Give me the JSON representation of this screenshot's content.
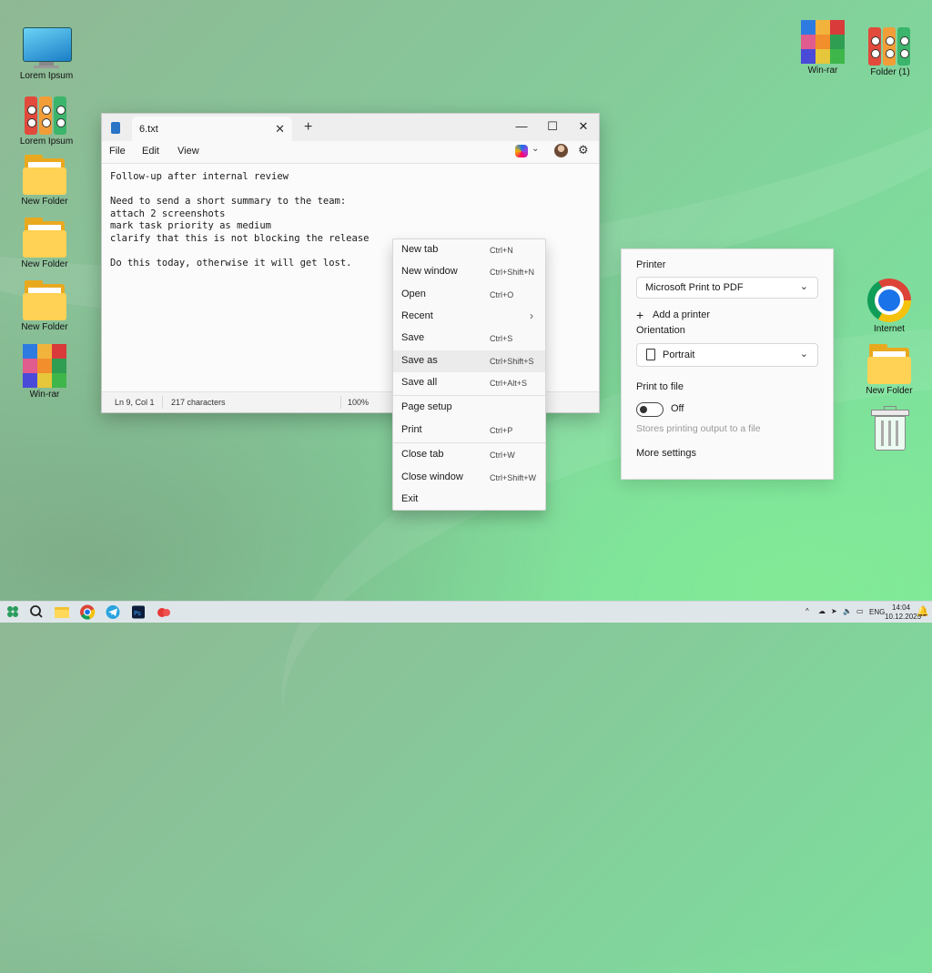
{
  "desktop": {
    "left_icons": [
      {
        "label": "Lorem Ipsum",
        "icon": "monitor-icon"
      },
      {
        "label": "Lorem Ipsum",
        "icon": "binders-icon"
      },
      {
        "label": "New Folder",
        "icon": "folder-icon"
      },
      {
        "label": "New Folder",
        "icon": "folder-icon"
      },
      {
        "label": "New Folder",
        "icon": "folder-icon"
      },
      {
        "label": "Win-rar",
        "icon": "winrar-icon"
      }
    ],
    "right_icons": [
      {
        "label": "Win-rar",
        "icon": "winrar-icon"
      },
      {
        "label": "Folder (1)",
        "icon": "binders-icon"
      },
      {
        "label": "Internet",
        "icon": "chrome-icon"
      },
      {
        "label": "New Folder",
        "icon": "folder-icon"
      },
      {
        "label": "",
        "icon": "recycle-bin-icon"
      }
    ]
  },
  "notepad": {
    "tab_title": "6.txt",
    "menu": [
      "File",
      "Edit",
      "View"
    ],
    "content": "Follow-up after internal review\n\nNeed to send a short summary to the team:\nattach 2 screenshots\nmark task priority as medium\nclarify that this is not blocking the release\n\nDo this today, otherwise it will get lost.",
    "status": {
      "position": "Ln 9, Col 1",
      "chars": "217 characters",
      "zoom": "100%"
    }
  },
  "file_menu": {
    "items": [
      {
        "label": "New tab",
        "shortcut": "Ctrl+N"
      },
      {
        "label": "New window",
        "shortcut": "Ctrl+Shift+N"
      },
      {
        "label": "Open",
        "shortcut": "Ctrl+O"
      },
      {
        "label": "Recent",
        "shortcut": ""
      },
      {
        "label": "Save",
        "shortcut": "Ctrl+S"
      },
      {
        "label": "Save as",
        "shortcut": "Ctrl+Shift+S"
      },
      {
        "label": "Save all",
        "shortcut": "Ctrl+Alt+S"
      },
      {
        "label": "Page setup",
        "shortcut": ""
      },
      {
        "label": "Print",
        "shortcut": "Ctrl+P"
      },
      {
        "label": "Close tab",
        "shortcut": "Ctrl+W"
      },
      {
        "label": "Close window",
        "shortcut": "Ctrl+Shift+W"
      },
      {
        "label": "Exit",
        "shortcut": ""
      }
    ],
    "highlighted": "Save as"
  },
  "print_panel": {
    "printer_label": "Printer",
    "printer_value": "Microsoft Print to PDF",
    "add_printer": "Add a printer",
    "orientation_label": "Orientation",
    "orientation_value": "Portrait",
    "print_to_file_label": "Print to file",
    "toggle_state": "Off",
    "toggle_desc": "Stores printing output to a file",
    "more_settings": "More settings"
  },
  "taskbar": {
    "language": "ENG",
    "time": "14:04",
    "date": "10.12.2025"
  }
}
